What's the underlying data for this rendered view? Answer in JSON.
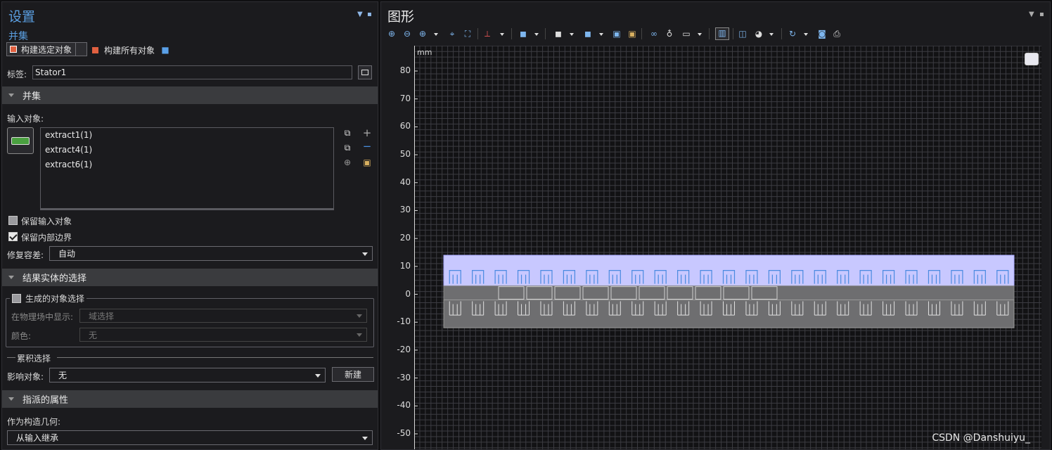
{
  "settings": {
    "title": "设置",
    "subtitle": "并集",
    "build_selected": "构建选定对象",
    "build_all": "构建所有对象",
    "label_caption": "标签:",
    "label_value": "Stator1",
    "sections": {
      "union": "并集",
      "result_selection": "结果实体的选择",
      "cumulative": "累积选择",
      "assigned": "指派的属性"
    },
    "input_objects_caption": "输入对象:",
    "input_objects": [
      "extract1(1)",
      "extract4(1)",
      "extract6(1)"
    ],
    "keep_input": "保留输入对象",
    "keep_interior": "保留内部边界",
    "repair_tol_caption": "修复容差:",
    "repair_tol_value": "自动",
    "generated_selection": "生成的对象选择",
    "show_in_physics_caption": "在物理场中显示:",
    "show_in_physics_value": "域选择",
    "color_caption": "颜色:",
    "color_value": "无",
    "contribute_caption": "影响对象:",
    "contribute_value": "无",
    "new_button": "新建",
    "construction_geom_caption": "作为构造几何:",
    "construction_geom_value": "从输入继承"
  },
  "graphics": {
    "title": "图形",
    "unit": "mm",
    "watermark": "CSDN @Danshuiyu_"
  },
  "chart_data": {
    "type": "other",
    "unit": "mm",
    "yticks": [
      80,
      70,
      60,
      50,
      40,
      30,
      20,
      10,
      0,
      -10,
      -20,
      -30,
      -40,
      -50
    ],
    "ylim": [
      -55,
      89
    ],
    "grid": true,
    "highlighted_band": {
      "y_min": 3,
      "y_max": 14,
      "color": "#c8c8ff"
    },
    "middle_band": {
      "y_min": -2,
      "y_max": 3,
      "color": "#6e6e70"
    },
    "lower_band": {
      "y_min": -12,
      "y_max": -2,
      "color": "#6e6e70"
    }
  },
  "colors": {
    "accent": "#5a9ee0",
    "panel": "#1b1b1e",
    "section": "#3a3b3e",
    "selection": "#c8c8ff"
  }
}
